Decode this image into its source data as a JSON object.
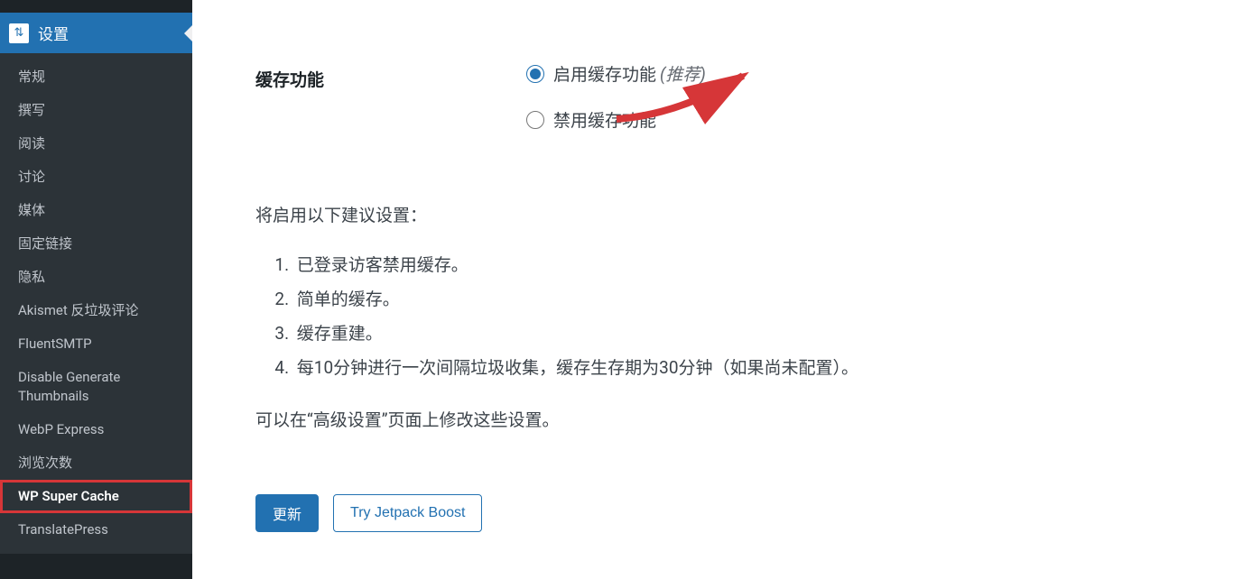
{
  "sidebar": {
    "header": {
      "label": "设置",
      "icon_name": "settings-slider-icon",
      "icon_glyph": "⇅"
    },
    "items": [
      {
        "label": "常规"
      },
      {
        "label": "撰写"
      },
      {
        "label": "阅读"
      },
      {
        "label": "讨论"
      },
      {
        "label": "媒体"
      },
      {
        "label": "固定链接"
      },
      {
        "label": "隐私"
      },
      {
        "label": "Akismet 反垃圾评论"
      },
      {
        "label": "FluentSMTP"
      },
      {
        "label": "Disable Generate Thumbnails"
      },
      {
        "label": "WebP Express"
      },
      {
        "label": "浏览次数"
      },
      {
        "label": "WP Super Cache"
      },
      {
        "label": "TranslatePress"
      }
    ],
    "active_index": 12
  },
  "cache": {
    "section_label": "缓存功能",
    "options": {
      "enable_label": "启用缓存功能",
      "enable_recommend": "(推荐)",
      "disable_label": "禁用缓存功能",
      "selected": "enable"
    }
  },
  "suggestions": {
    "intro": "将启用以下建议设置：",
    "items": [
      "已登录访客禁用缓存。",
      "简单的缓存。",
      "缓存重建。",
      "每10分钟进行一次间隔垃圾收集，缓存生存期为30分钟（如果尚未配置）。"
    ],
    "modify_note": "可以在“高级设置”页面上修改这些设置。"
  },
  "buttons": {
    "update": "更新",
    "jetpack": "Try Jetpack Boost"
  },
  "annotation": {
    "arrow_color": "#d63638"
  }
}
